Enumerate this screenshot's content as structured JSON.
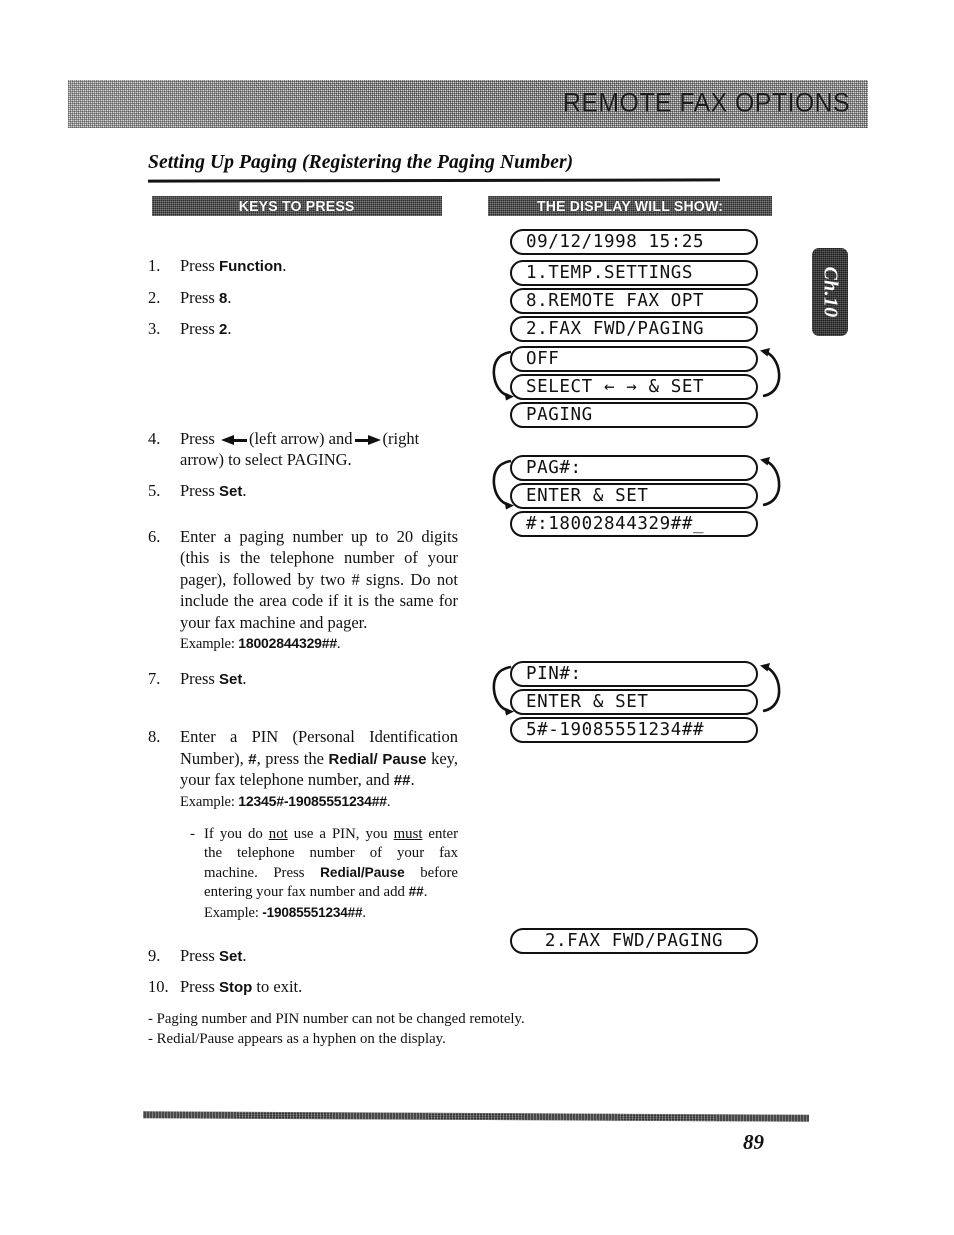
{
  "header": {
    "title": "REMOTE FAX OPTIONS"
  },
  "section": {
    "title": "Setting Up Paging (Registering the Paging Number)"
  },
  "columns": {
    "keys_label": "KEYS TO PRESS",
    "display_label": "THE DISPLAY WILL SHOW:"
  },
  "steps": [
    {
      "num": "1.",
      "text_before": "Press ",
      "bold": "Function",
      "text_after": "."
    },
    {
      "num": "2.",
      "text_before": "Press ",
      "bold": "8",
      "text_after": "."
    },
    {
      "num": "3.",
      "text_before": "Press ",
      "bold": "2",
      "text_after": "."
    },
    {
      "num": "4.",
      "text_before": "Press ",
      "mid": "(left arrow) and",
      "text_after": "(right arrow) to select PAGING."
    },
    {
      "num": "5.",
      "text_before": "Press ",
      "bold": "Set",
      "text_after": "."
    },
    {
      "num": "6.",
      "body": "Enter a paging number up to 20 digits (this is the telephone number of your pager), followed by two # signs. Do not include the area code if it is the same for your fax machine and pager.",
      "example_label": "Example: ",
      "example_value": "18002844329##",
      "example_end": "."
    },
    {
      "num": "7.",
      "text_before": "Press ",
      "bold": "Set",
      "text_after": "."
    },
    {
      "num": "8.",
      "part1": "Enter a PIN (Personal Identification Number), ",
      "part2": "#",
      "part3": ", press the ",
      "part4": "Redial/ Pause",
      "part5": " key, your fax telephone number, and ",
      "part6": "##",
      "part7": ".",
      "example_label": "Example: ",
      "example_value": "12345#-19085551234##",
      "example_end": ".",
      "note": {
        "dash": "-",
        "a": "If you do ",
        "u1": "not",
        "b": " use a PIN, you ",
        "u2": "must",
        "c": " enter the telephone number of your fax machine. Press ",
        "bold1": "Redial/Pause",
        "d": " before entering your fax number and add ",
        "bold2": "##",
        "e": ".",
        "example_label": "Example: ",
        "example_value": "-19085551234##",
        "example_end": "."
      }
    },
    {
      "num": "9.",
      "text_before": "Press ",
      "bold": "Set",
      "text_after": "."
    },
    {
      "num": "10.",
      "text_before": "Press ",
      "bold": "Stop",
      "text_after": " to exit."
    }
  ],
  "displays": {
    "clock": "09/12/1998 15:25",
    "temp_settings": "1.TEMP.SETTINGS",
    "remote_fax_opt": "8.REMOTE FAX OPT",
    "fax_fwd_paging": "2.FAX FWD/PAGING",
    "off": "OFF",
    "select_set": "SELECT ← → & SET",
    "paging": "PAGING",
    "pag_number_prompt": "PAG#:",
    "enter_and_set_1": "ENTER & SET",
    "pag_number_entry": "#:18002844329##_",
    "pin_number_prompt": "PIN#:",
    "enter_and_set_2": "ENTER & SET",
    "pin_number_entry": "5#-19085551234##",
    "final_fax_fwd_paging": "2.FAX FWD/PAGING"
  },
  "chapter_tab": {
    "label": "Ch.10"
  },
  "footer_notes": [
    "- Paging number and PIN number can not be changed remotely.",
    "- Redial/Pause appears as a hyphen on the display."
  ],
  "page_number": "89"
}
